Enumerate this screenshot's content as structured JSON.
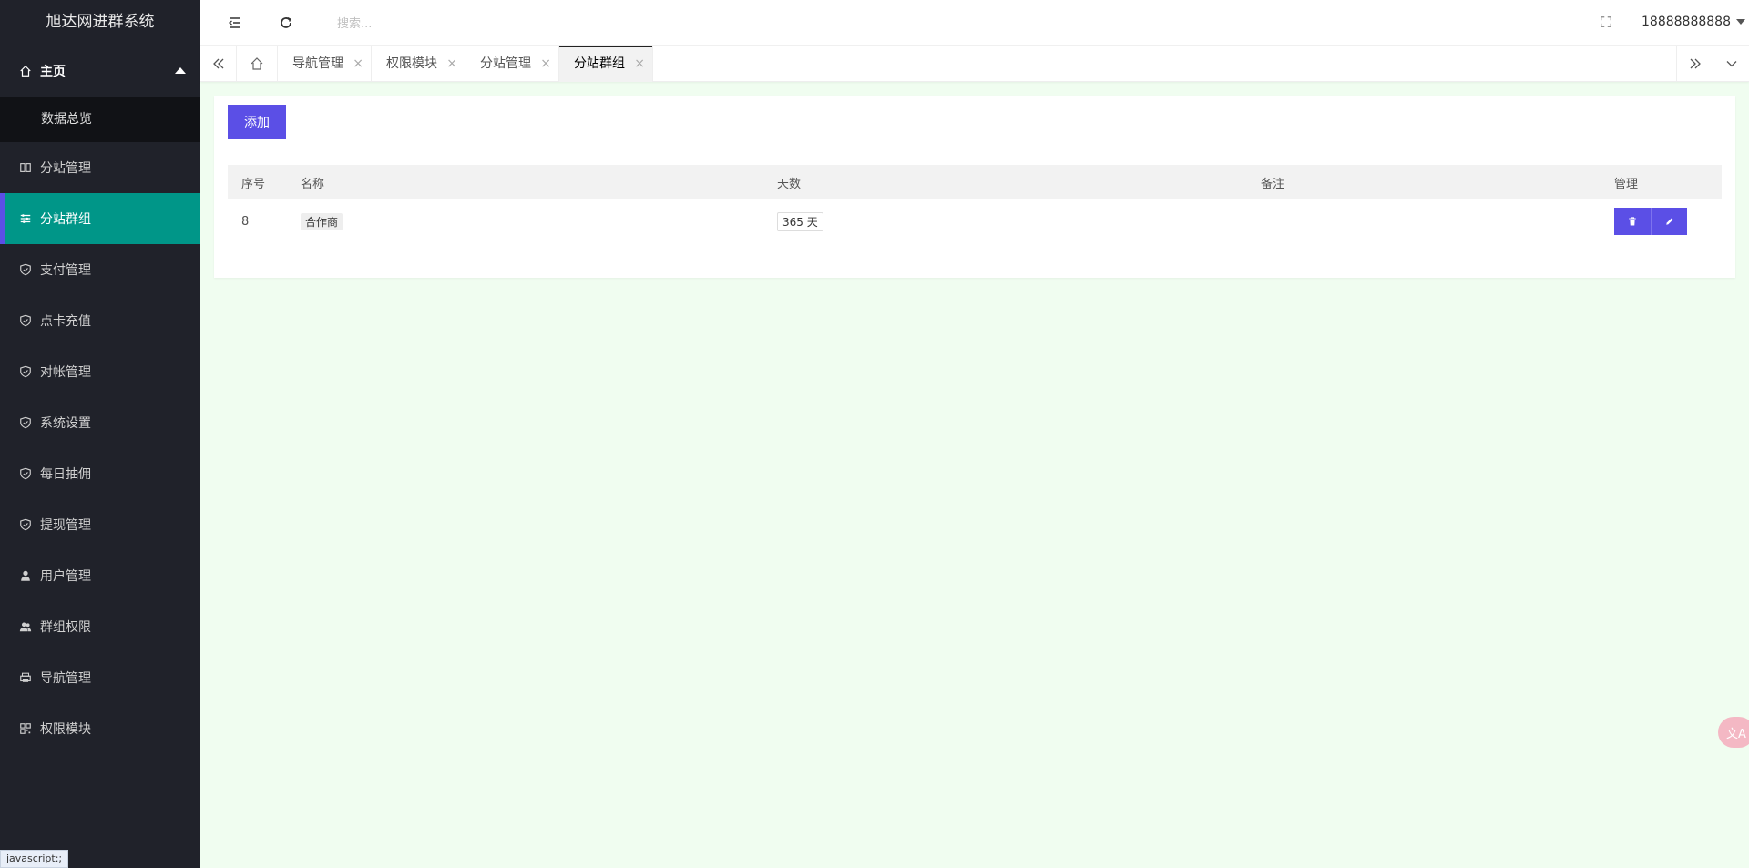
{
  "app": {
    "title": "旭达网进群系统"
  },
  "sidebar": {
    "home": {
      "label": "主页"
    },
    "home_sub": {
      "label": "数据总览"
    },
    "items": [
      {
        "label": "分站管理",
        "icon": "columns-icon"
      },
      {
        "label": "分站群组",
        "icon": "sliders-icon",
        "active": true
      },
      {
        "label": "支付管理",
        "icon": "shield-icon"
      },
      {
        "label": "点卡充值",
        "icon": "shield-icon"
      },
      {
        "label": "对帐管理",
        "icon": "shield-icon"
      },
      {
        "label": "系统设置",
        "icon": "shield-icon"
      },
      {
        "label": "每日抽佣",
        "icon": "shield-icon"
      },
      {
        "label": "提现管理",
        "icon": "shield-icon"
      },
      {
        "label": "用户管理",
        "icon": "user-icon"
      },
      {
        "label": "群组权限",
        "icon": "users-icon"
      },
      {
        "label": "导航管理",
        "icon": "printer-icon"
      },
      {
        "label": "权限模块",
        "icon": "grid-icon"
      }
    ]
  },
  "header": {
    "search_placeholder": "搜索...",
    "username": "18888888888"
  },
  "tabs": [
    {
      "label": "导航管理",
      "active": false
    },
    {
      "label": "权限模块",
      "active": false
    },
    {
      "label": "分站管理",
      "active": false
    },
    {
      "label": "分站群组",
      "active": true
    }
  ],
  "tab_close": "×",
  "main": {
    "add_label": "添加",
    "table": {
      "columns": [
        "序号",
        "名称",
        "天数",
        "备注",
        "管理"
      ],
      "rows": [
        {
          "id": "8",
          "name": "合作商",
          "days": "365 天",
          "remark": ""
        }
      ]
    }
  },
  "status_bar": {
    "text": "javascript:;"
  },
  "translate_fab": {
    "text": "文A"
  },
  "colors": {
    "sidebar_bg": "#20222a",
    "active_bg": "#009688",
    "accent": "#5b4fe6",
    "content_bg": "#f0fdf0"
  }
}
